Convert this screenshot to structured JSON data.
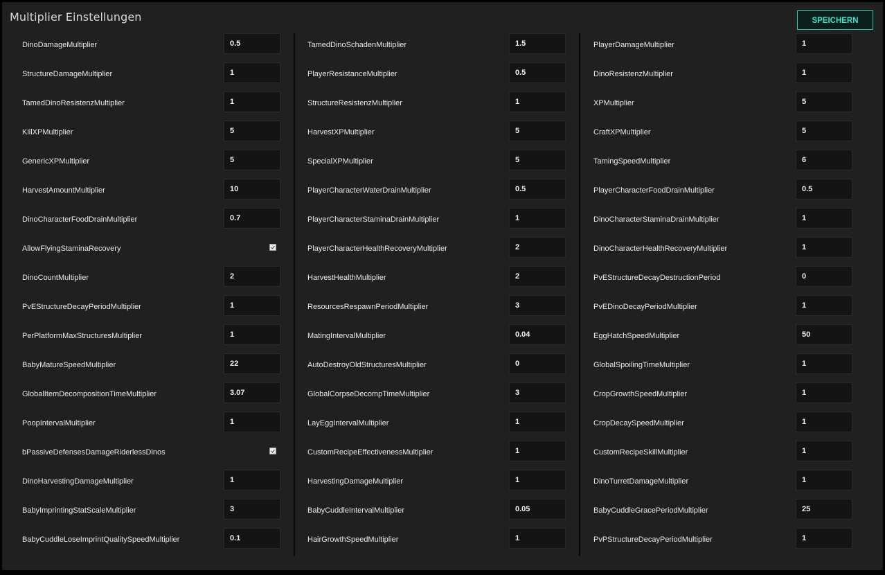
{
  "header": {
    "title": "Multiplier Einstellungen",
    "save_label": "SPEICHERN"
  },
  "colors": {
    "background": "#202020",
    "accent": "#2fc7b0",
    "input_bg": "#141414",
    "text": "#e8e8e8"
  },
  "columns": [
    {
      "rows": [
        {
          "label": "DinoDamageMultiplier",
          "value": "0.5"
        },
        {
          "label": "StructureDamageMultiplier",
          "value": "1"
        },
        {
          "label": "TamedDinoResistenzMultiplier",
          "value": "1"
        },
        {
          "label": "KillXPMultiplier",
          "value": "5"
        },
        {
          "label": "GenericXPMultiplier",
          "value": "5"
        },
        {
          "label": "HarvestAmountMultiplier",
          "value": "10"
        },
        {
          "label": "DinoCharacterFoodDrainMultiplier",
          "value": "0.7"
        },
        {
          "label": "AllowFlyingStaminaRecovery",
          "checkbox": true,
          "checked": true
        },
        {
          "label": "DinoCountMultiplier",
          "value": "2"
        },
        {
          "label": "PvEStructureDecayPeriodMultiplier",
          "value": "1"
        },
        {
          "label": "PerPlatformMaxStructuresMultiplier",
          "value": "1"
        },
        {
          "label": "BabyMatureSpeedMultiplier",
          "value": "22"
        },
        {
          "label": "GlobalItemDecompositionTimeMultiplier",
          "value": "3.07"
        },
        {
          "label": "PoopIntervalMultiplier",
          "value": "1"
        },
        {
          "label": "bPassiveDefensesDamageRiderlessDinos",
          "checkbox": true,
          "checked": true
        },
        {
          "label": "DinoHarvestingDamageMultiplier",
          "value": "1"
        },
        {
          "label": "BabyImprintingStatScaleMultiplier",
          "value": "3"
        },
        {
          "label": "BabyCuddleLoseImprintQualitySpeedMultiplier",
          "value": "0.1"
        }
      ]
    },
    {
      "rows": [
        {
          "label": "TamedDinoSchadenMultiplier",
          "value": "1.5"
        },
        {
          "label": "PlayerResistanceMultiplier",
          "value": "0.5"
        },
        {
          "label": "StructureResistenzMultiplier",
          "value": "1"
        },
        {
          "label": "HarvestXPMultiplier",
          "value": "5"
        },
        {
          "label": "SpecialXPMultiplier",
          "value": "5"
        },
        {
          "label": "PlayerCharacterWaterDrainMultiplier",
          "value": "0.5"
        },
        {
          "label": "PlayerCharacterStaminaDrainMultiplier",
          "value": "1"
        },
        {
          "label": "PlayerCharacterHealthRecoveryMultiplier",
          "value": "2"
        },
        {
          "label": "HarvestHealthMultiplier",
          "value": "2"
        },
        {
          "label": "ResourcesRespawnPeriodMultiplier",
          "value": "3"
        },
        {
          "label": "MatingIntervalMultiplier",
          "value": "0.04"
        },
        {
          "label": "AutoDestroyOldStructuresMultiplier",
          "value": "0"
        },
        {
          "label": "GlobalCorpseDecompTimeMultiplier",
          "value": "3"
        },
        {
          "label": "LayEggIntervalMultiplier",
          "value": "1"
        },
        {
          "label": "CustomRecipeEffectivenessMultiplier",
          "value": "1"
        },
        {
          "label": "HarvestingDamageMultiplier",
          "value": "1"
        },
        {
          "label": "BabyCuddleIntervalMultiplier",
          "value": "0.05"
        },
        {
          "label": "HairGrowthSpeedMultiplier",
          "value": "1"
        }
      ]
    },
    {
      "rows": [
        {
          "label": "PlayerDamageMultiplier",
          "value": "1"
        },
        {
          "label": "DinoResistenzMultiplier",
          "value": "1"
        },
        {
          "label": "XPMultiplier",
          "value": "5"
        },
        {
          "label": "CraftXPMultiplier",
          "value": "5"
        },
        {
          "label": "TamingSpeedMultiplier",
          "value": "6"
        },
        {
          "label": "PlayerCharacterFoodDrainMultiplier",
          "value": "0.5"
        },
        {
          "label": "DinoCharacterStaminaDrainMultiplier",
          "value": "1"
        },
        {
          "label": "DinoCharacterHealthRecoveryMultiplier",
          "value": "1"
        },
        {
          "label": "PvEStructureDecayDestructionPeriod",
          "value": "0"
        },
        {
          "label": "PvEDinoDecayPeriodMultiplier",
          "value": "1"
        },
        {
          "label": "EggHatchSpeedMultiplier",
          "value": "50"
        },
        {
          "label": "GlobalSpoilingTimeMultiplier",
          "value": "1"
        },
        {
          "label": "CropGrowthSpeedMultiplier",
          "value": "1"
        },
        {
          "label": "CropDecaySpeedMultiplier",
          "value": "1"
        },
        {
          "label": "CustomRecipeSkillMultiplier",
          "value": "1"
        },
        {
          "label": "DinoTurretDamageMultiplier",
          "value": "1"
        },
        {
          "label": "BabyCuddleGracePeriodMultiplier",
          "value": "25"
        },
        {
          "label": "PvPStructureDecayPeriodMultiplier",
          "value": "1"
        }
      ]
    }
  ]
}
